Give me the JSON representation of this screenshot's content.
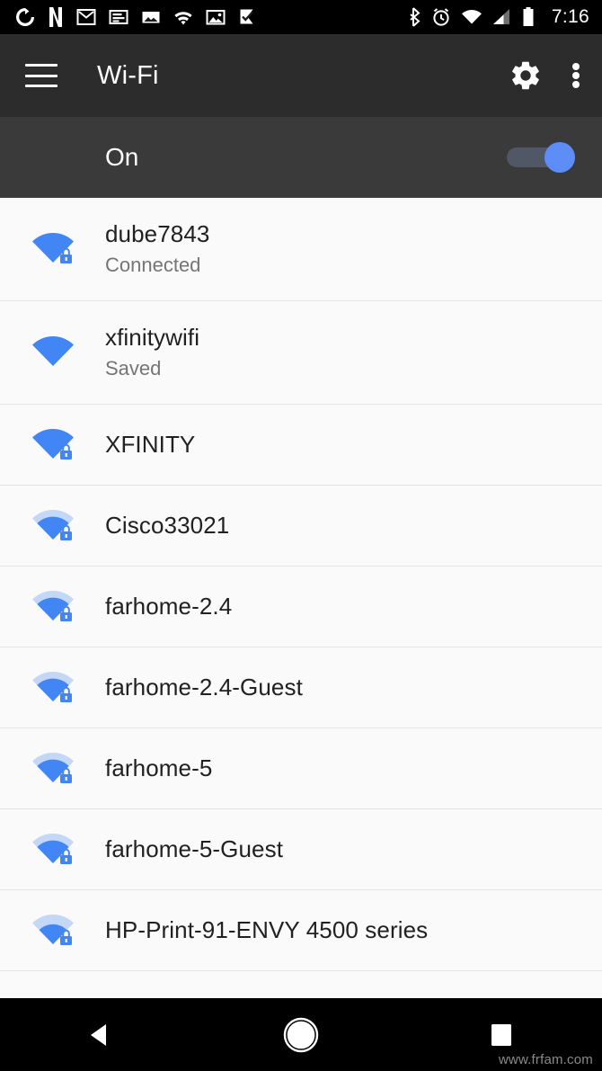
{
  "status_bar": {
    "background": "#000000",
    "notification_icons": [
      "sync-circle-icon",
      "netflix-icon",
      "gmail-icon",
      "news-article-icon",
      "photo-icon",
      "wifi-notification-icon",
      "gallery-image-icon",
      "checkmark-flag-icon"
    ],
    "system_icons": [
      "bluetooth-icon",
      "alarm-clock-icon",
      "wifi-signal-icon",
      "cellular-signal-icon",
      "battery-icon"
    ],
    "clock": "7:16"
  },
  "app_bar": {
    "background": "#2c2c2c",
    "menu_icon": "hamburger-menu-icon",
    "title": "Wi-Fi",
    "settings_icon": "gear-icon",
    "overflow_icon": "more-vertical-icon"
  },
  "wifi_toggle": {
    "label": "On",
    "state": "on",
    "accent": "#5d8ef7",
    "background": "#3a3a3a"
  },
  "networks": [
    {
      "name": "dube7843",
      "status": "Connected",
      "secured": true,
      "signal": 4,
      "icon": "wifi-signal-4-lock-icon"
    },
    {
      "name": "xfinitywifi",
      "status": "Saved",
      "secured": false,
      "signal": 4,
      "icon": "wifi-signal-4-open-icon"
    },
    {
      "name": "XFINITY",
      "status": "",
      "secured": true,
      "signal": 4,
      "icon": "wifi-signal-4-lock-icon"
    },
    {
      "name": "Cisco33021",
      "status": "",
      "secured": true,
      "signal": 3,
      "icon": "wifi-signal-3-lock-icon"
    },
    {
      "name": "farhome-2.4",
      "status": "",
      "secured": true,
      "signal": 3,
      "icon": "wifi-signal-3-lock-icon"
    },
    {
      "name": "farhome-2.4-Guest",
      "status": "",
      "secured": true,
      "signal": 3,
      "icon": "wifi-signal-3-lock-icon"
    },
    {
      "name": "farhome-5",
      "status": "",
      "secured": true,
      "signal": 3,
      "icon": "wifi-signal-3-lock-icon"
    },
    {
      "name": "farhome-5-Guest",
      "status": "",
      "secured": true,
      "signal": 3,
      "icon": "wifi-signal-3-lock-icon"
    },
    {
      "name": "HP-Print-91-ENVY 4500 series",
      "status": "",
      "secured": true,
      "signal": 2,
      "icon": "wifi-signal-2-lock-icon"
    }
  ],
  "nav_bar": {
    "background": "#000000",
    "back_icon": "back-triangle-icon",
    "home_icon": "home-circle-icon",
    "recents_icon": "recents-square-icon"
  },
  "watermark": "www.frfam.com",
  "colors": {
    "wifi_blue": "#4285f4",
    "wifi_blue_faded": "#c3d7f7",
    "list_background": "#fafafa",
    "divider": "#e4e4e4",
    "primary_text": "#212121",
    "secondary_text": "#757575"
  }
}
